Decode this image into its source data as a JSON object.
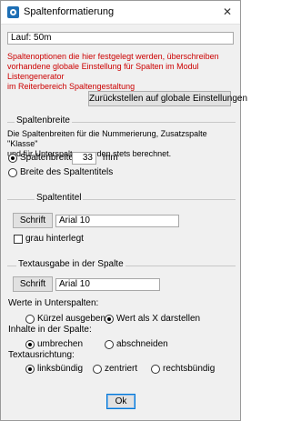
{
  "window": {
    "title": "Spaltenformatierung",
    "close_glyph": "✕"
  },
  "header": {
    "lauf_value": "Lauf: 50m"
  },
  "warning_lines": [
    "Spaltenoptionen die hier festgelegt werden, überschreiben",
    "vorhandene globale Einstellung für Spalten im Modul Listengenerator",
    "im Reiterbereich Spaltengestaltung"
  ],
  "reset_button": "Zurückstellen auf globale Einstellungen",
  "spaltenbreite": {
    "group_label": "Spaltenbreite",
    "desc_lines": [
      "Die Spaltenbreiten für die Nummerierung, Zusatzspalte \"Klasse\"",
      "und für Unterspalten werden stets berechnet."
    ],
    "option_width_label": "Spaltenbreite",
    "width_value": "33",
    "unit": "mm",
    "option_title_label": "Breite des Spaltentitels",
    "selected": "width"
  },
  "spaltentitel": {
    "group_label": "Spaltentitel",
    "font_button": "Schrift",
    "font_value": "Arial 10",
    "grey_label": "grau hinterlegt",
    "grey_checked": false
  },
  "textausgabe": {
    "group_label": "Textausgabe in der Spalte",
    "font_button": "Schrift",
    "font_value": "Arial 10",
    "unterspalten_label": "Werte in Unterspalten:",
    "opt_kuerzel": "Kürzel ausgeben",
    "opt_wert_x": "Wert als X darstellen",
    "unterspalten_selected": "wert_x",
    "inhalte_label": "Inhalte in der Spalte:",
    "opt_umbrechen": "umbrechen",
    "opt_abschneiden": "abschneiden",
    "inhalte_selected": "umbrechen",
    "ausrichtung_label": "Textausrichtung:",
    "opt_links": "linksbündig",
    "opt_zentriert": "zentriert",
    "opt_rechts": "rechtsbündig",
    "ausrichtung_selected": "links"
  },
  "ok_button": "Ok"
}
